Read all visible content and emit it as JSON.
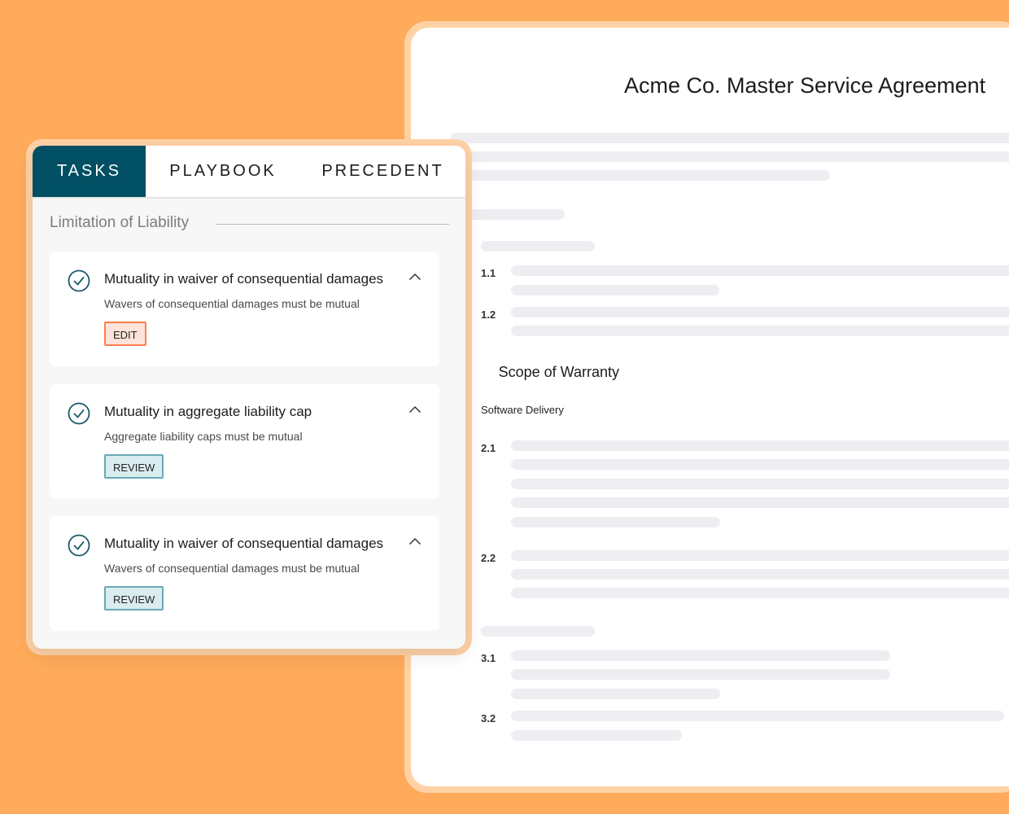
{
  "document": {
    "title": "Acme Co. Master Service Agreement",
    "clause_numbers": [
      "1.1",
      "1.2",
      "2.1",
      "2.2",
      "3.1",
      "3.2"
    ],
    "section_heading": "Scope of Warranty",
    "sub_heading": "Software Delivery"
  },
  "tabs": [
    {
      "label": "TASKS",
      "active": true
    },
    {
      "label": "PLAYBOOK",
      "active": false
    },
    {
      "label": "PRECEDENT",
      "active": false
    }
  ],
  "section": {
    "label": "Limitation of Liability"
  },
  "cards": [
    {
      "title": "Mutuality in waiver of consequential damages",
      "description": "Wavers of consequential damages must be mutual",
      "action": "EDIT"
    },
    {
      "title": "Mutuality in aggregate liability cap",
      "description": "Aggregate liability caps must be mutual",
      "action": "REVIEW"
    },
    {
      "title": "Mutuality in waiver of consequential damages",
      "description": "Wavers of consequential damages must be mutual",
      "action": "REVIEW"
    }
  ],
  "colors": {
    "background": "#ffab5b",
    "active_tab": "#014f63",
    "check_icon": "#1a5a69",
    "edit_border": "#ff7e50",
    "review_border": "#6aaab5"
  }
}
